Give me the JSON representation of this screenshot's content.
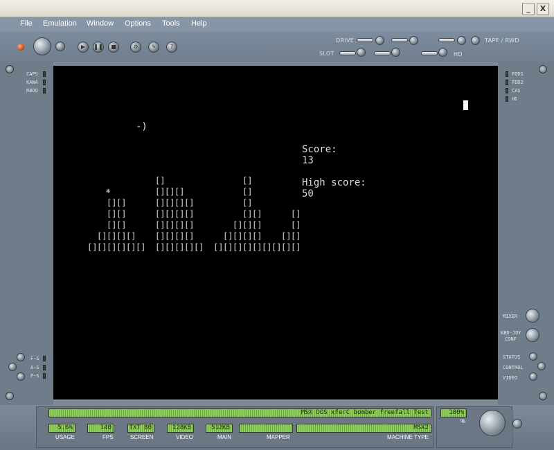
{
  "window": {
    "minimize": "_",
    "close": "X"
  },
  "menu": [
    "File",
    "Emulation",
    "Window",
    "Options",
    "Tools",
    "Help"
  ],
  "toolbar": {
    "drive_label": "DRIVE",
    "slot_label": "SLOT",
    "tape_label": "TAPE / RWD",
    "hd_label": "HD"
  },
  "left_indicators": [
    "CAPS",
    "KANA",
    "RBOO"
  ],
  "left_bottom_indicators": [
    "F-S",
    "A-S",
    "P-S"
  ],
  "right_indicators": [
    "FDD1",
    "FDD2",
    "CAS",
    "HD"
  ],
  "right_controls": {
    "mixer": "MIXER",
    "kbd_joy": "KBD-JOY",
    "conf": "CONF",
    "status": "STATUS",
    "control": "CONTROL",
    "video": "VIDEO"
  },
  "game": {
    "score_label": "Score:",
    "score_value": "13",
    "high_score_label": "High score:",
    "high_score_value": "50",
    "plane": "-)",
    "bomb": "*",
    "block": "[]"
  },
  "status": {
    "title_lcd": "MSX DOS xferC bomber freefall Test",
    "percent_value": "100%",
    "percent_label": "%",
    "usage_value": "5.6%",
    "usage_label": "USAGE",
    "fps_value": "140",
    "fps_label": "FPS",
    "screen_value": "TXT 80",
    "screen_label": "SCREEN",
    "video_value": "128KB",
    "video_label": "VIDEO",
    "main_value": "512KB",
    "main_label": "MAIN",
    "mapper_value": "",
    "mapper_label": "MAPPER",
    "machine_value": "MSX2",
    "machine_label": "MACHINE TYPE"
  }
}
